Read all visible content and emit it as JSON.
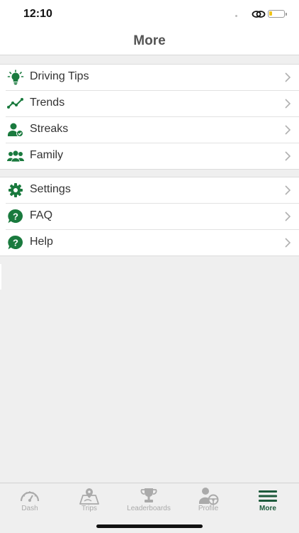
{
  "status": {
    "time": "12:10"
  },
  "header": {
    "title": "More"
  },
  "colors": {
    "accent": "#1a7a3e",
    "active_tab": "#1d5a3b",
    "inactive_tab": "#aaaaaa"
  },
  "menu": {
    "group1": [
      {
        "label": "Driving Tips",
        "icon": "lightbulb-icon"
      },
      {
        "label": "Trends",
        "icon": "trend-line-icon"
      },
      {
        "label": "Streaks",
        "icon": "user-check-icon"
      },
      {
        "label": "Family",
        "icon": "family-icon"
      }
    ],
    "group2": [
      {
        "label": "Settings",
        "icon": "gear-icon"
      },
      {
        "label": "FAQ",
        "icon": "question-icon"
      },
      {
        "label": "Help",
        "icon": "question-icon"
      }
    ]
  },
  "tabs": [
    {
      "label": "Dash",
      "icon": "speedometer-icon"
    },
    {
      "label": "Trips",
      "icon": "map-pin-icon"
    },
    {
      "label": "Leaderboards",
      "icon": "trophy-icon"
    },
    {
      "label": "Profile",
      "icon": "profile-wheel-icon"
    },
    {
      "label": "More",
      "icon": "hamburger-icon",
      "active": true
    }
  ]
}
